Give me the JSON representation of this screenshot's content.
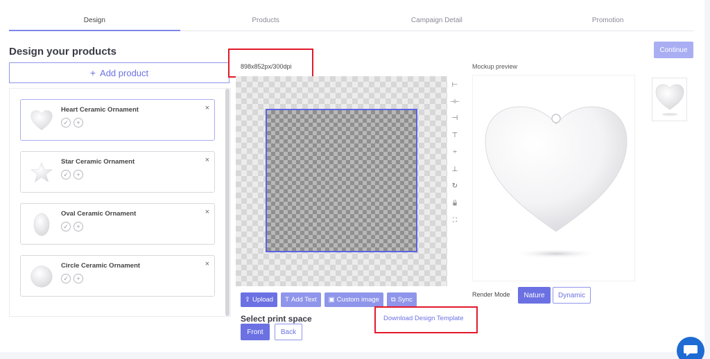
{
  "tabs": [
    {
      "label": "Design",
      "active": true
    },
    {
      "label": "Products",
      "active": false
    },
    {
      "label": "Campaign Detail",
      "active": false
    },
    {
      "label": "Promotion",
      "active": false
    }
  ],
  "continue_label": "Continue",
  "left": {
    "title": "Design your products",
    "add_product_label": "Add product",
    "add_product_icon": "plus-icon",
    "products": [
      {
        "name": "Heart Ceramic Ornament",
        "shape": "heart",
        "active": true
      },
      {
        "name": "Star Ceramic Ornament",
        "shape": "star",
        "active": false
      },
      {
        "name": "Oval Ceramic Ornament",
        "shape": "oval",
        "active": false
      },
      {
        "name": "Circle Ceramic Ornament",
        "shape": "circle",
        "active": false
      }
    ],
    "close_glyph": "×"
  },
  "canvas": {
    "dimensions": "898x852px/300dpi",
    "tools": [
      {
        "name": "align-left-icon",
        "glyph": "⊢"
      },
      {
        "name": "align-center-horizontal-icon",
        "glyph": "⊣⊢"
      },
      {
        "name": "align-right-icon",
        "glyph": "⊣"
      },
      {
        "name": "align-top-icon",
        "glyph": "⊤"
      },
      {
        "name": "align-center-vertical-icon",
        "glyph": "÷"
      },
      {
        "name": "align-bottom-icon",
        "glyph": "⊥"
      },
      {
        "name": "rotate-icon",
        "glyph": "↻"
      },
      {
        "name": "lock-icon",
        "glyph": "🔒"
      },
      {
        "name": "fullscreen-icon",
        "glyph": "⛶"
      }
    ],
    "buttons": {
      "upload": "Upload",
      "add_text": "Add Text",
      "custom_image": "Custom image",
      "sync": "Sync"
    },
    "print_space_title": "Select print space",
    "print_space_front": "Front",
    "print_space_back": "Back",
    "download_template": "Download Design Template"
  },
  "mockup": {
    "label": "Mockup preview",
    "render_mode_label": "Render Mode",
    "nature_label": "Nature",
    "dynamic_label": "Dynamic"
  },
  "colors": {
    "accent": "#6b71e2",
    "accent_light": "#a9aef3",
    "highlight_red": "#e3182a",
    "chat": "#1e6bd3"
  }
}
